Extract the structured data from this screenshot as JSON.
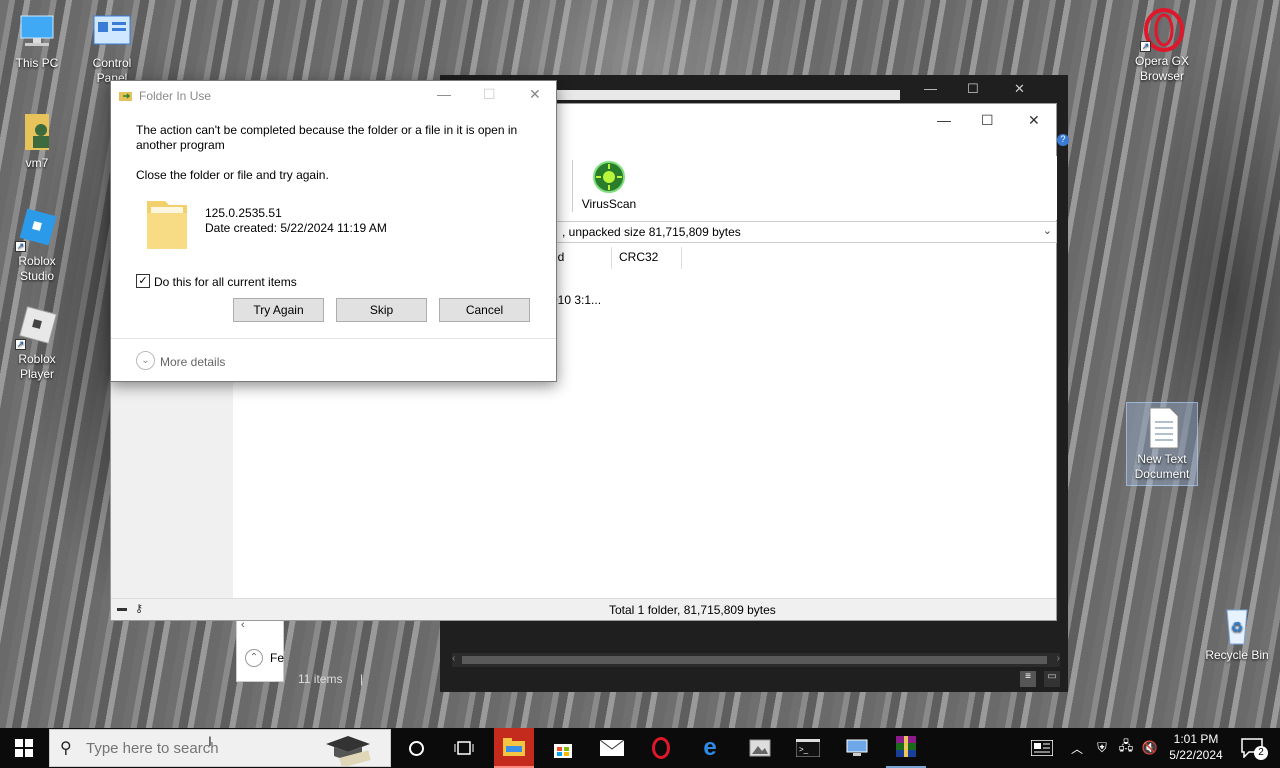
{
  "desktop": {
    "icons": [
      {
        "label": "This PC",
        "icon": "computer-icon"
      },
      {
        "label": "Control Panel",
        "icon": "control-panel-icon"
      },
      {
        "label": "vm7",
        "icon": "user-folder-icon"
      },
      {
        "label": "Roblox Studio",
        "icon": "roblox-studio-icon"
      },
      {
        "label": "Roblox Player",
        "icon": "roblox-player-icon"
      },
      {
        "label": "Opera GX Browser",
        "icon": "opera-gx-icon"
      },
      {
        "label": "New Text Document",
        "icon": "text-document-icon"
      },
      {
        "label": "Recycle Bin",
        "icon": "recycle-bin-icon"
      }
    ]
  },
  "explorer": {
    "item_count": "11 items",
    "nav_partial": "Fe"
  },
  "winrar": {
    "toolbar": {
      "virusscan_label": "VirusScan"
    },
    "path_text": ", unpacked size 81,715,809 bytes",
    "columns": [
      "ed",
      "CRC32"
    ],
    "row_partial": "010 3:1...",
    "status_text": "Total 1 folder, 81,715,809 bytes"
  },
  "dialog": {
    "title": "Folder In Use",
    "message": "The action can't be completed because the folder or a file in it is open in another program",
    "instruction": "Close the folder or file and try again.",
    "file_name": "125.0.2535.51",
    "file_date": "Date created: 5/22/2024 11:19 AM",
    "checkbox_label": "Do this for all current items",
    "checkbox_checked": true,
    "buttons": {
      "try_again": "Try Again",
      "skip": "Skip",
      "cancel": "Cancel"
    },
    "more_details": "More details"
  },
  "taskbar": {
    "search_placeholder": "Type here to search",
    "pinned": [
      "cortana-icon",
      "task-view-icon",
      "file-explorer-icon",
      "store-icon",
      "mail-icon",
      "opera-icon",
      "edge-icon",
      "photos-icon",
      "terminal-icon",
      "network-icon",
      "winrar-icon"
    ],
    "time": "1:01 PM",
    "date": "5/22/2024",
    "notification_count": "2"
  },
  "colors": {
    "accent": "#0078d7",
    "taskbar": "#0b0b0b",
    "active_app": "#c42b1c"
  }
}
